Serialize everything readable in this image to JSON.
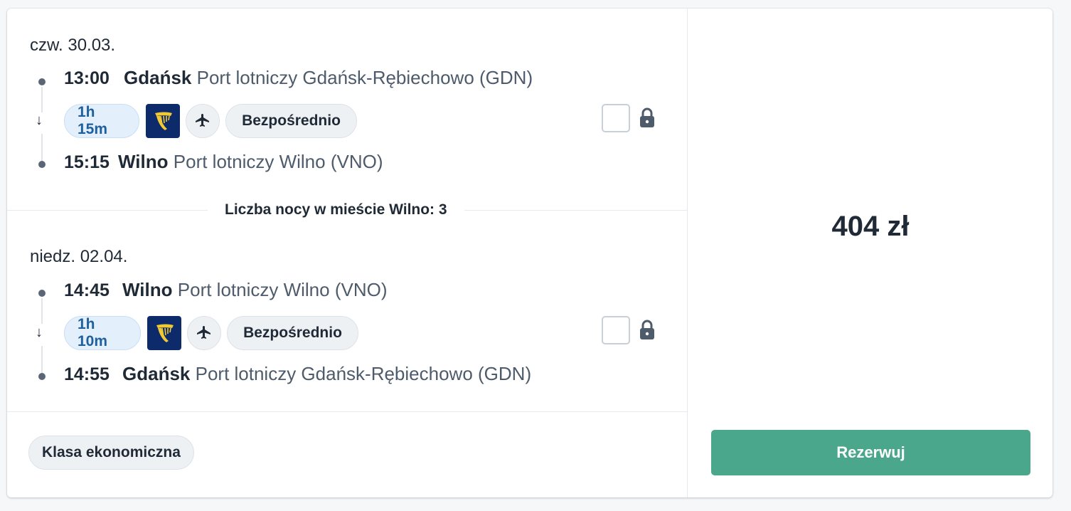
{
  "outbound": {
    "date": "czw. 30.03.",
    "dep_time": "13:00",
    "dep_city": "Gdańsk",
    "dep_airport": "Port lotniczy Gdańsk-Rębiechowo (GDN)",
    "duration": "1h 15m",
    "airline_icon": "ryanair-harp-icon",
    "stops": "Bezpośrednio",
    "arr_time": "15:15",
    "arr_city": "Wilno",
    "arr_airport": "Port lotniczy Wilno (VNO)"
  },
  "nights_label": "Liczba nocy w mieście Wilno: 3",
  "return": {
    "date": "niedz. 02.04.",
    "dep_time": "14:45",
    "dep_city": "Wilno",
    "dep_airport": "Port lotniczy Wilno (VNO)",
    "duration": "1h 10m",
    "airline_icon": "ryanair-harp-icon",
    "stops": "Bezpośrednio",
    "arr_time": "14:55",
    "arr_city": "Gdańsk",
    "arr_airport": "Port lotniczy Gdańsk-Rębiechowo (GDN)"
  },
  "cabin_class": "Klasa ekonomiczna",
  "price": "404 zł",
  "book_label": "Rezerwuj",
  "colors": {
    "book_button": "#4aa78c",
    "duration_chip": "#e3f0fb",
    "airline_logo_bg": "#0d2a6b",
    "airline_logo_fg": "#f1c933"
  }
}
